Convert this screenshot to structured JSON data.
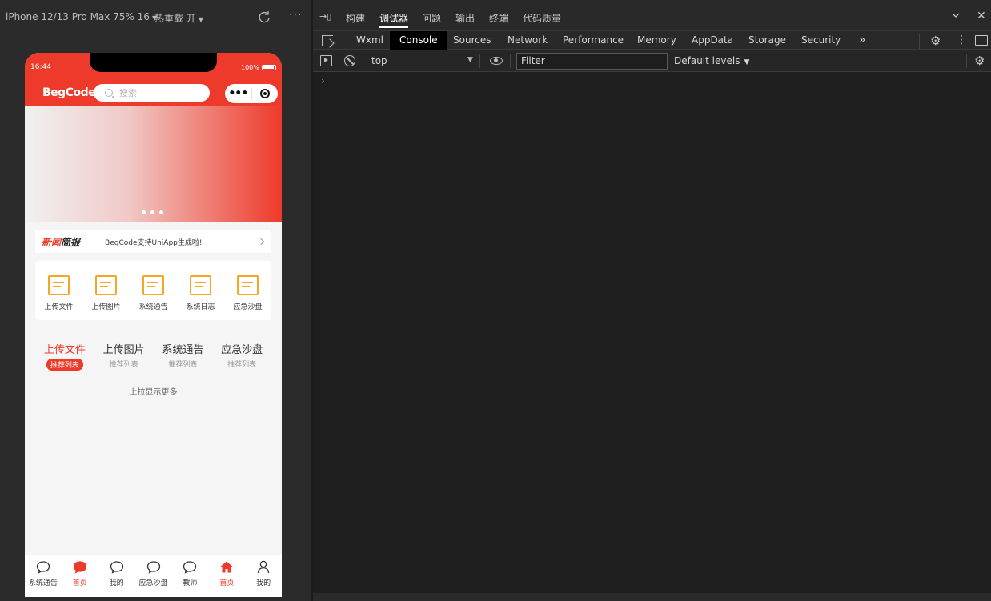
{
  "simulator": {
    "device": "iPhone 12/13 Pro Max 75% 16",
    "hot_reload": "热重载 开",
    "more": "···"
  },
  "phone": {
    "status": {
      "time": "16:44",
      "battery": "100%"
    },
    "header": {
      "logo": "BegCode",
      "search_placeholder": "搜索"
    },
    "news": {
      "logo_red": "新闻",
      "logo_black": "简报",
      "text": "BegCode支持UniApp生成啦!"
    },
    "grid": [
      {
        "label": "上传文件"
      },
      {
        "label": "上传图片"
      },
      {
        "label": "系统通告"
      },
      {
        "label": "系统日志"
      },
      {
        "label": "应急沙盘"
      }
    ],
    "tabs": [
      {
        "title": "上传文件",
        "sub": "推荐列表"
      },
      {
        "title": "上传图片",
        "sub": "推荐列表"
      },
      {
        "title": "系统通告",
        "sub": "推荐列表"
      },
      {
        "title": "应急沙盘",
        "sub": "推荐列表"
      }
    ],
    "load_more": "上拉显示更多",
    "tabbar": [
      {
        "label": "系统通告",
        "icon": "chat-bubble-icon"
      },
      {
        "label": "首页",
        "icon": "chat-bubble-filled-icon"
      },
      {
        "label": "我的",
        "icon": "chat-bubble-icon"
      },
      {
        "label": "应急沙盘",
        "icon": "chat-bubble-icon"
      },
      {
        "label": "教师",
        "icon": "chat-bubble-icon"
      },
      {
        "label": "首页",
        "icon": "home-filled-icon"
      },
      {
        "label": "我的",
        "icon": "user-icon"
      }
    ],
    "accent": "#ee3a2a"
  },
  "devtools": {
    "top_tabs": [
      "构建",
      "调试器",
      "问题",
      "输出",
      "终端",
      "代码质量"
    ],
    "tabs": [
      "Wxml",
      "Console",
      "Sources",
      "Network",
      "Performance",
      "Memory",
      "AppData",
      "Storage",
      "Security"
    ],
    "overflow": "»",
    "console": {
      "context": "top",
      "filter_placeholder": "Filter",
      "levels": "Default levels",
      "prompt": "›"
    }
  }
}
